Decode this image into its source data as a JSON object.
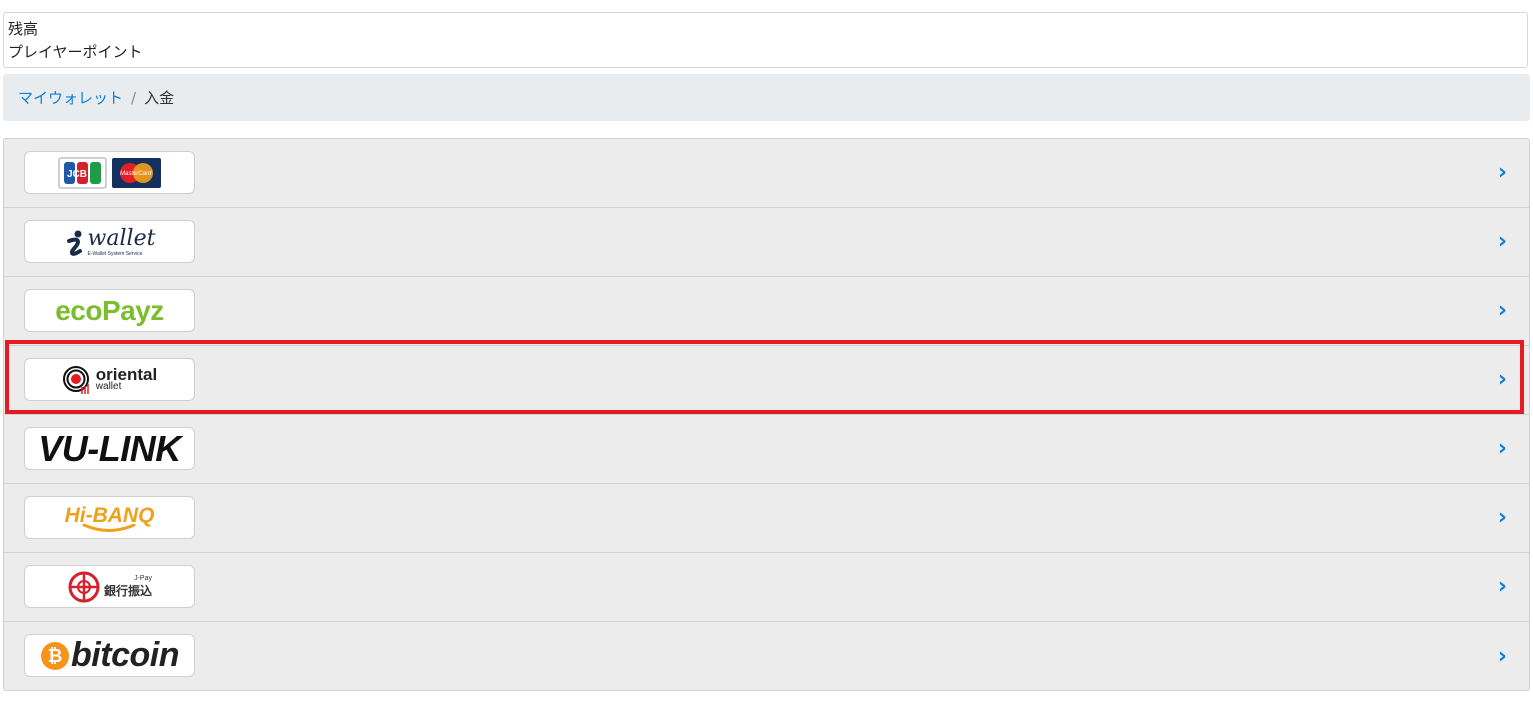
{
  "balance": {
    "label": "残高",
    "points_label": "プレイヤーポイント"
  },
  "breadcrumb": {
    "parent": "マイウォレット",
    "separator": "/",
    "current": "入金"
  },
  "payment_methods": [
    {
      "name": "card",
      "logo_text": [
        "JCB",
        "MasterCard"
      ]
    },
    {
      "name": "iwallet",
      "logo_text": "wallet",
      "logo_sub": "E-Wallet System Service"
    },
    {
      "name": "ecopayz",
      "logo_text": "ecoPayz"
    },
    {
      "name": "oriental-wallet",
      "logo_text": "oriental",
      "logo_sub": "wallet"
    },
    {
      "name": "vu-link",
      "logo_text": "VU-LINK"
    },
    {
      "name": "hi-banq",
      "logo_text": "Hi-BANQ"
    },
    {
      "name": "bank-transfer",
      "logo_text": "銀行振込",
      "logo_sub": "J-Pay"
    },
    {
      "name": "bitcoin",
      "logo_text": "bitcoin"
    }
  ],
  "chevron_glyph": "›",
  "highlighted_method": "oriental-wallet",
  "colors": {
    "link": "#0d7fd8",
    "highlight": "#e51b23",
    "row_bg": "#ececec",
    "breadcrumb_bg": "#e9ecef"
  }
}
